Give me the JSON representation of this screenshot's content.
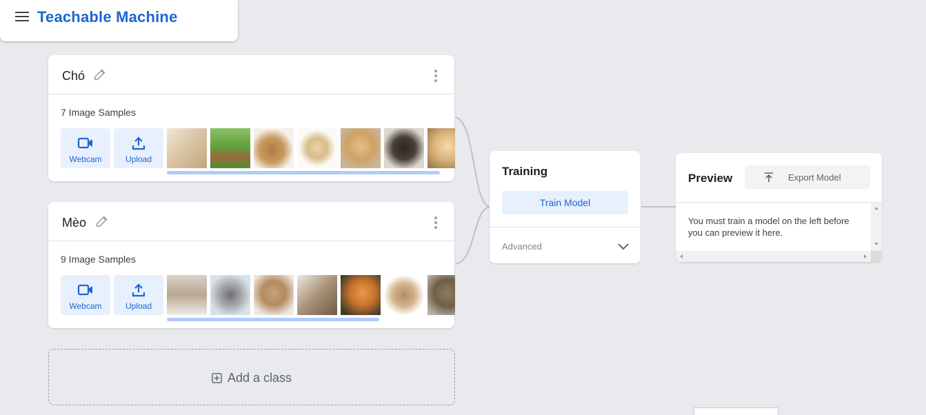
{
  "app": {
    "title": "Teachable Machine",
    "menu_icon": "hamburger-menu-icon"
  },
  "classes": [
    {
      "name": "Chó",
      "samples_text": "7 Image Samples",
      "webcam_label": "Webcam",
      "upload_label": "Upload",
      "progress": 0.95,
      "thumbnails": [
        "puppy-photo",
        "beagle-photo",
        "brown-dog-photo",
        "labrador-photo",
        "golden-puppy-photo",
        "black-puppy-photo",
        "golden-retriever-photo"
      ]
    },
    {
      "name": "Mèo",
      "samples_text": "9 Image Samples",
      "webcam_label": "Webcam",
      "upload_label": "Upload",
      "progress": 0.74,
      "thumbnails": [
        "kittens-photo",
        "grey-kitten-photo",
        "fluffy-cat-photo",
        "tabby-lying-photo",
        "orange-cat-photo",
        "surprised-cat-photo",
        "tabby-cat-photo"
      ]
    }
  ],
  "add_class": {
    "label": "Add a class"
  },
  "training": {
    "title": "Training",
    "train_button": "Train Model",
    "advanced_label": "Advanced"
  },
  "preview": {
    "title": "Preview",
    "export_button": "Export Model",
    "message": "You must train a model on the left before you can preview it here."
  },
  "colors": {
    "accent": "#1967d2",
    "button_bg": "#e8f0fe",
    "background": "#e8eaed"
  }
}
